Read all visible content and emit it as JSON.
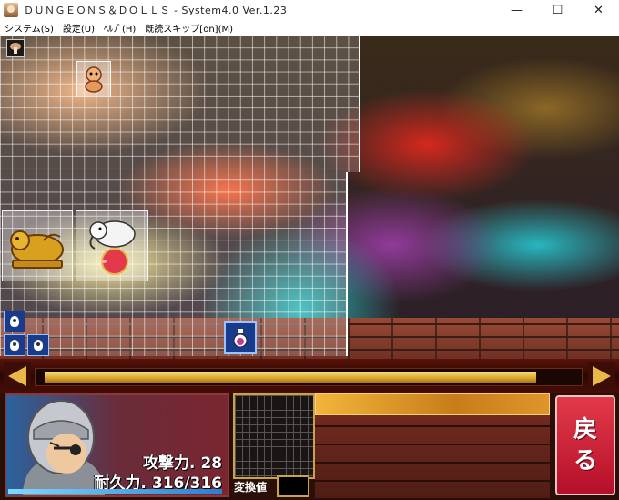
{
  "window": {
    "title": "ＤＵＮＧＥＯＮＳ＆ＤＯＬＬＳ - System4.0 Ver.1.23",
    "minimize": "—",
    "maximize": "☐",
    "close": "✕"
  },
  "menu": {
    "items": [
      "システム(S)",
      "設定(U)",
      "ﾍﾙﾌﾟ(H)",
      "既読スキップ[on](M)"
    ]
  },
  "character": {
    "attack_label": "攻撃力.",
    "attack_value": "28",
    "durability_label": "耐久力.",
    "durability_value": "316/316"
  },
  "conversion": {
    "label": "変換値"
  },
  "back_button": {
    "chars": [
      "戻",
      "る"
    ]
  },
  "colors": {
    "accent_gold": "#e8b84a",
    "back_red": "#d22a3c"
  },
  "icons": [
    "mushroom-icon",
    "doll-icon",
    "golden-beast-icon",
    "elephant-on-ball-icon",
    "small-doll-icon",
    "potion-icon"
  ]
}
